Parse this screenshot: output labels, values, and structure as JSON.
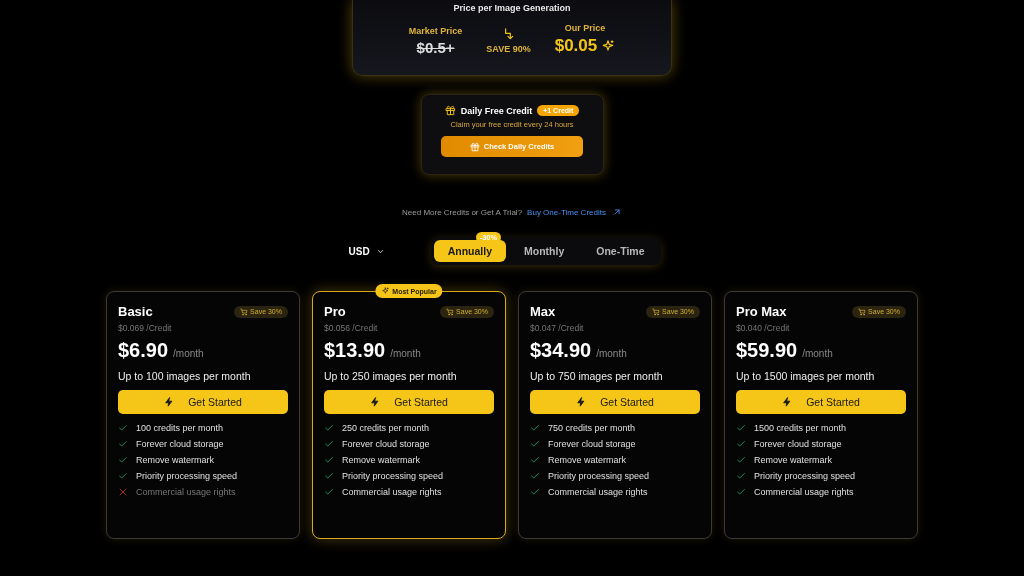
{
  "price_panel": {
    "title": "Price per Image Generation",
    "market_label": "Market Price",
    "market_price": "$0.5+",
    "save_label": "SAVE 90%",
    "our_label": "Our Price",
    "our_price": "$0.05"
  },
  "daily_credit": {
    "title": "Daily Free Credit",
    "badge": "+1 Credit",
    "subtitle": "Claim your free credit every 24 hours",
    "button": "Check Daily Credits"
  },
  "trial_line": {
    "text": "Need More Credits or Get A Trial?",
    "link": "Buy One-Time Credits"
  },
  "currency": "USD",
  "billing_tabs": [
    {
      "label": "Annually",
      "selected": true,
      "badge": "-30%"
    },
    {
      "label": "Monthly",
      "selected": false
    },
    {
      "label": "One-Time",
      "selected": false
    }
  ],
  "plans": [
    {
      "name": "Basic",
      "popular": false,
      "save": "Save 30%",
      "per_credit": "$0.069 /Credit",
      "price": "$6.90",
      "period": "/month",
      "summary": "Up to 100 images per month",
      "button": "Get Started",
      "features": [
        {
          "text": "100 credits per month",
          "included": true
        },
        {
          "text": "Forever cloud storage",
          "included": true
        },
        {
          "text": "Remove watermark",
          "included": true
        },
        {
          "text": "Priority processing speed",
          "included": true
        },
        {
          "text": "Commercial usage rights",
          "included": false
        }
      ]
    },
    {
      "name": "Pro",
      "popular": true,
      "popular_label": "Most Popular",
      "save": "Save 30%",
      "per_credit": "$0.056 /Credit",
      "price": "$13.90",
      "period": "/month",
      "summary": "Up to 250 images per month",
      "button": "Get Started",
      "features": [
        {
          "text": "250 credits per month",
          "included": true
        },
        {
          "text": "Forever cloud storage",
          "included": true
        },
        {
          "text": "Remove watermark",
          "included": true
        },
        {
          "text": "Priority processing speed",
          "included": true
        },
        {
          "text": "Commercial usage rights",
          "included": true
        }
      ]
    },
    {
      "name": "Max",
      "popular": false,
      "save": "Save 30%",
      "per_credit": "$0.047 /Credit",
      "price": "$34.90",
      "period": "/month",
      "summary": "Up to 750 images per month",
      "button": "Get Started",
      "features": [
        {
          "text": "750 credits per month",
          "included": true
        },
        {
          "text": "Forever cloud storage",
          "included": true
        },
        {
          "text": "Remove watermark",
          "included": true
        },
        {
          "text": "Priority processing speed",
          "included": true
        },
        {
          "text": "Commercial usage rights",
          "included": true
        }
      ]
    },
    {
      "name": "Pro Max",
      "popular": false,
      "save": "Save 30%",
      "per_credit": "$0.040 /Credit",
      "price": "$59.90",
      "period": "/month",
      "summary": "Up to 1500 images per month",
      "button": "Get Started",
      "features": [
        {
          "text": "1500 credits per month",
          "included": true
        },
        {
          "text": "Forever cloud storage",
          "included": true
        },
        {
          "text": "Remove watermark",
          "included": true
        },
        {
          "text": "Priority processing speed",
          "included": true
        },
        {
          "text": "Commercial usage rights",
          "included": true
        }
      ]
    }
  ]
}
